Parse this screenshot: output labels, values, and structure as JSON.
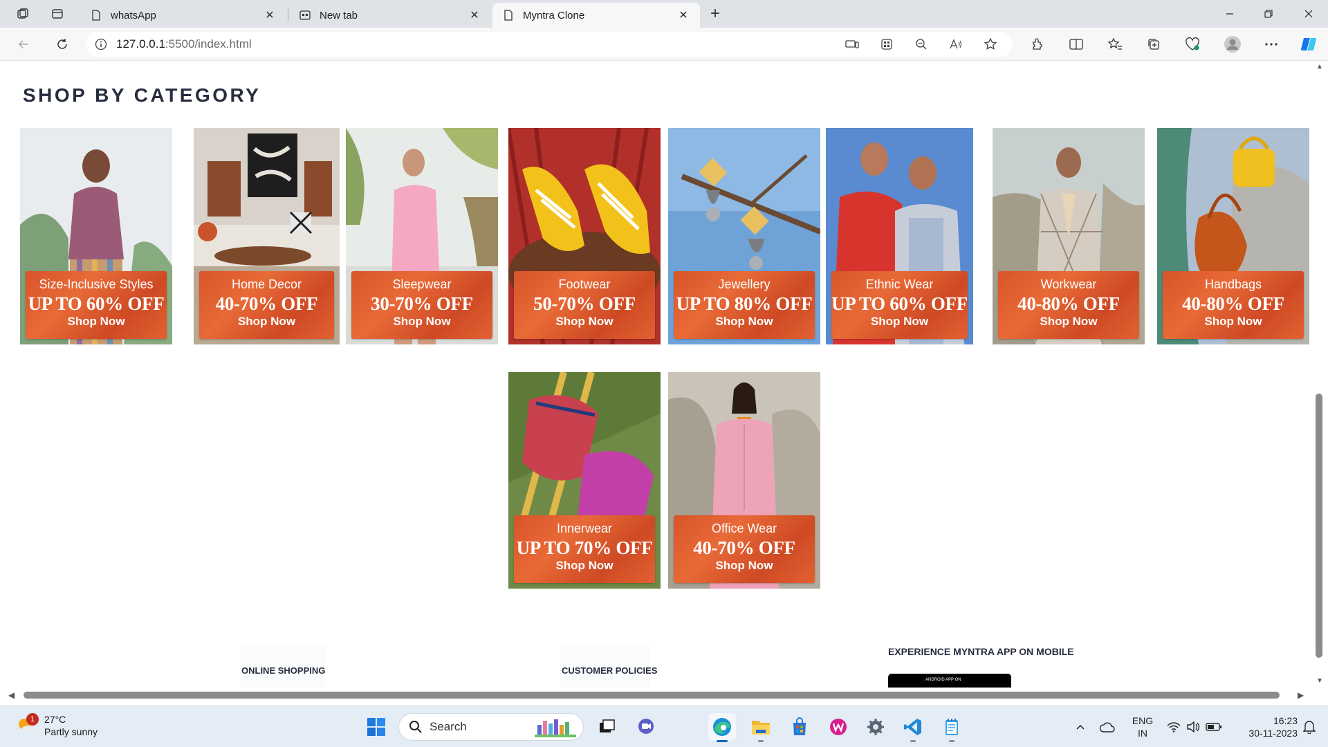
{
  "browser": {
    "tabs": [
      {
        "title": "whatsApp",
        "active": false
      },
      {
        "title": "New tab",
        "active": false
      },
      {
        "title": "Myntra Clone",
        "active": true
      }
    ],
    "address_host": "127.0.0.1",
    "address_path": ":5500/index.html"
  },
  "page": {
    "heading": "SHOP BY CATEGORY",
    "categories": [
      {
        "name": "Size-Inclusive Styles",
        "offer": "UP TO 60% OFF",
        "cta": "Shop Now"
      },
      {
        "name": "Home Decor",
        "offer": "40-70% OFF",
        "cta": "Shop Now"
      },
      {
        "name": "Sleepwear",
        "offer": "30-70% OFF",
        "cta": "Shop Now"
      },
      {
        "name": "Footwear",
        "offer": "50-70% OFF",
        "cta": "Shop Now"
      },
      {
        "name": "Jewellery",
        "offer": "UP TO 80% OFF",
        "cta": "Shop Now"
      },
      {
        "name": "Ethnic Wear",
        "offer": "UP TO 60% OFF",
        "cta": "Shop Now"
      },
      {
        "name": "Workwear",
        "offer": "40-80% OFF",
        "cta": "Shop Now"
      },
      {
        "name": "Handbags",
        "offer": "40-80% OFF",
        "cta": "Shop Now"
      },
      {
        "name": "Innerwear",
        "offer": "UP TO 70% OFF",
        "cta": "Shop Now"
      },
      {
        "name": "Office Wear",
        "offer": "40-70% OFF",
        "cta": "Shop Now"
      }
    ],
    "footer": {
      "online_shopping": "ONLINE SHOPPING",
      "customer_policies": "CUSTOMER POLICIES",
      "app_heading": "EXPERIENCE MYNTRA APP ON MOBILE",
      "badge_text": "ANDROID APP ON"
    }
  },
  "taskbar": {
    "temperature": "27°C",
    "weather": "Partly sunny",
    "weather_badge": "1",
    "search_label": "Search",
    "lang": "ENG",
    "region": "IN",
    "time": "16:23",
    "date": "30-11-2023"
  },
  "colors": {
    "offer_panel": "#d8542a",
    "heading": "#282c3f",
    "accent": "#0067c0"
  }
}
